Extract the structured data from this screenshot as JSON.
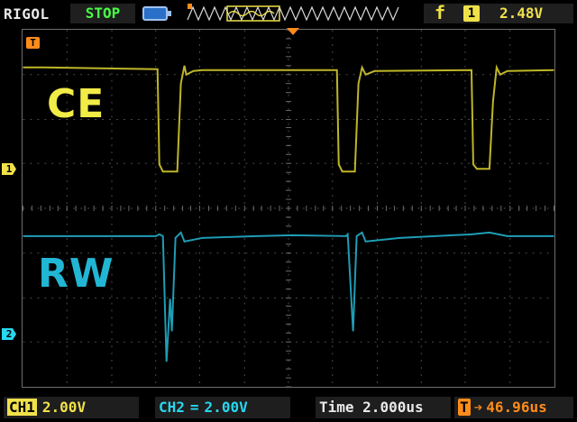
{
  "header": {
    "brand": "RIGOL",
    "run_status": "STOP",
    "trigger_symbol": "f",
    "trigger_channel": "1",
    "trigger_level": "2.48V"
  },
  "markers": {
    "trigger_pos": "T",
    "ch1": "1",
    "ch2": "2"
  },
  "labels": {
    "ch1_name": "CE",
    "ch2_name": "RW"
  },
  "footer": {
    "ch1_tag": "CH1",
    "ch1_scale": "2.00V",
    "ch2_label": "CH2",
    "ch2_scale": "2.00V",
    "time_label": "Time",
    "time_scale": "2.000us",
    "offset_tag": "T",
    "offset_value": "46.96us"
  },
  "colors": {
    "ch1": "#f0e14a",
    "ch2": "#27d7ef",
    "trigger": "#ff8c1a"
  }
}
